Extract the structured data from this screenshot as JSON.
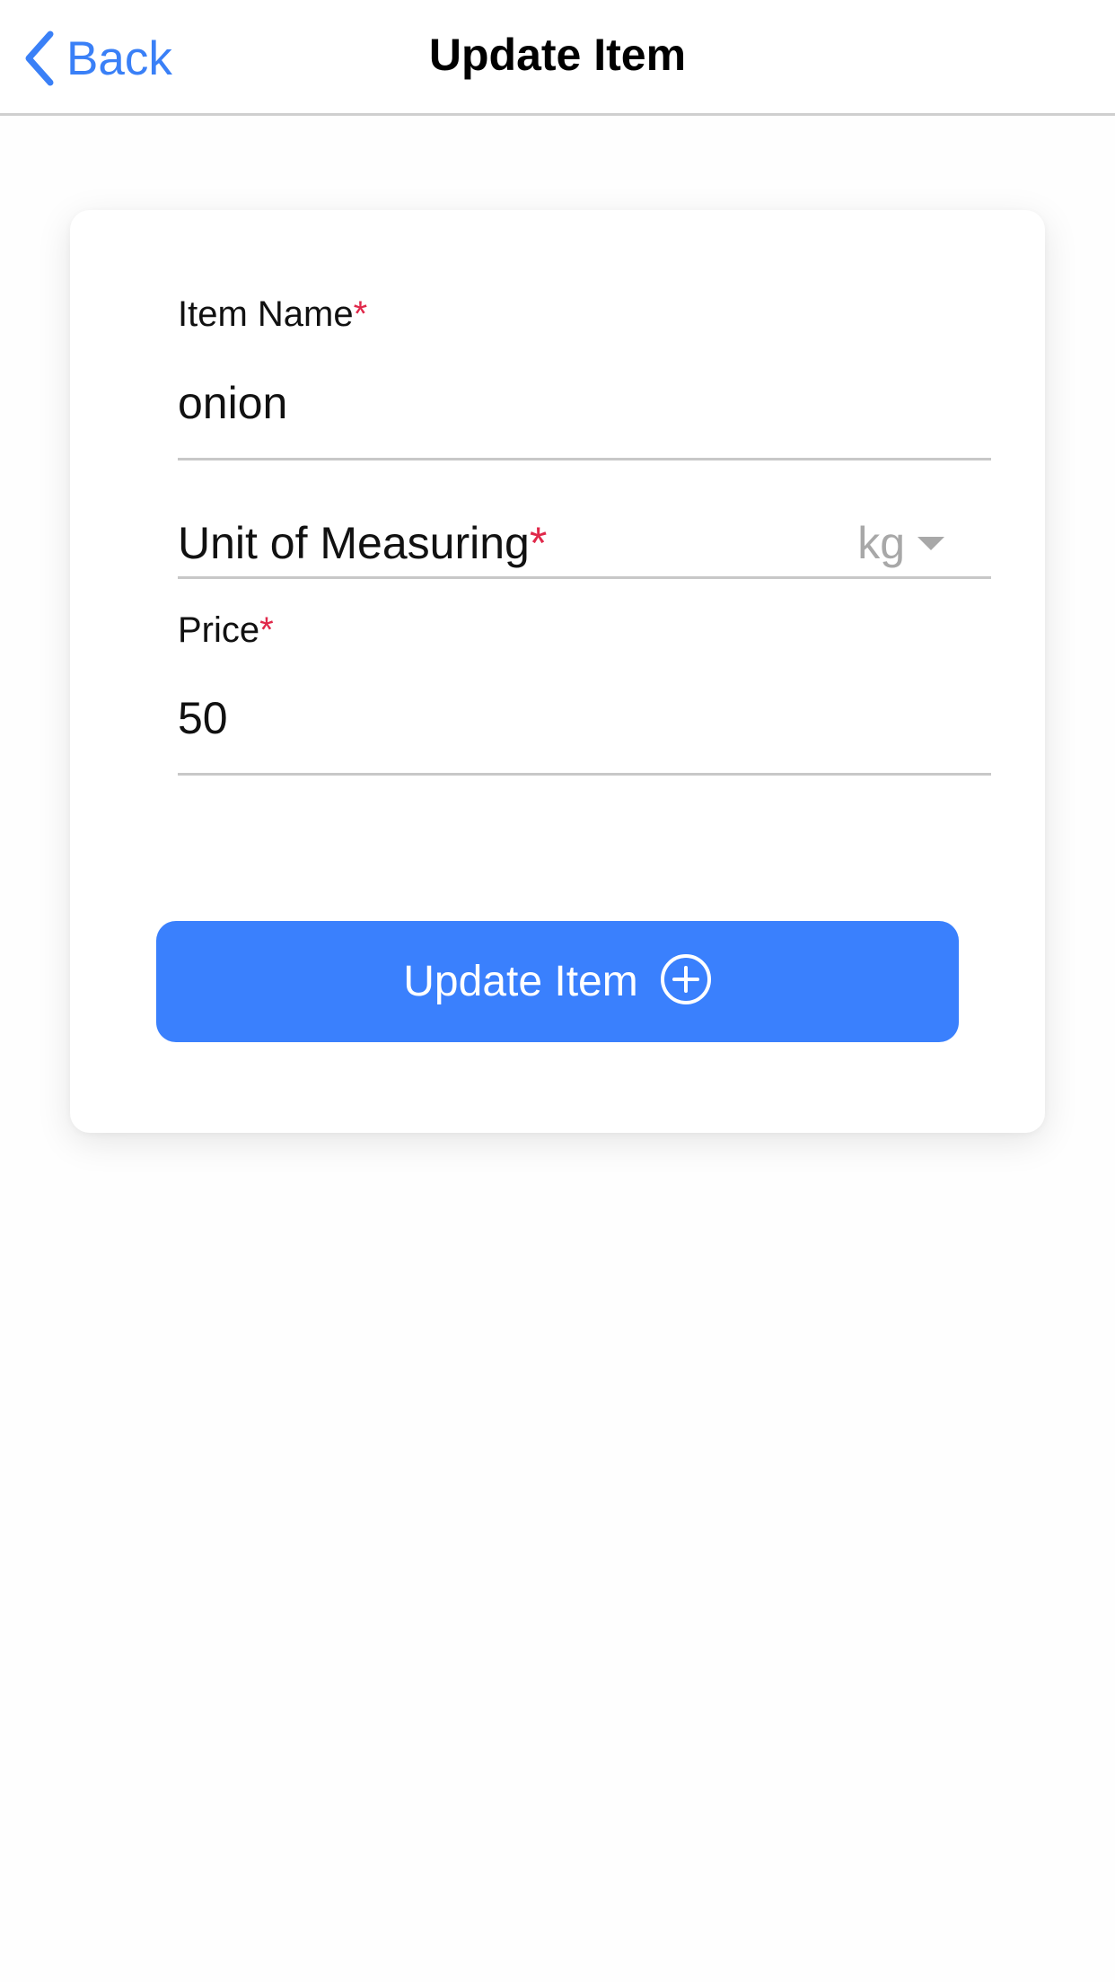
{
  "nav": {
    "back_label": "Back",
    "title": "Update Item"
  },
  "form": {
    "item_name": {
      "label": "Item Name",
      "required_mark": "*",
      "value": "onion"
    },
    "unit": {
      "label": "Unit of Measuring",
      "required_mark": "*",
      "selected": "kg"
    },
    "price": {
      "label": "Price",
      "required_mark": "*",
      "value": "50"
    },
    "submit_label": "Update Item"
  },
  "icons": {
    "back": "chevron-left-icon",
    "select": "caret-down-icon",
    "submit": "plus-circle-icon"
  },
  "colors": {
    "accent": "#3a80fd",
    "required": "#e0284a",
    "placeholder": "#a8a8a8"
  }
}
